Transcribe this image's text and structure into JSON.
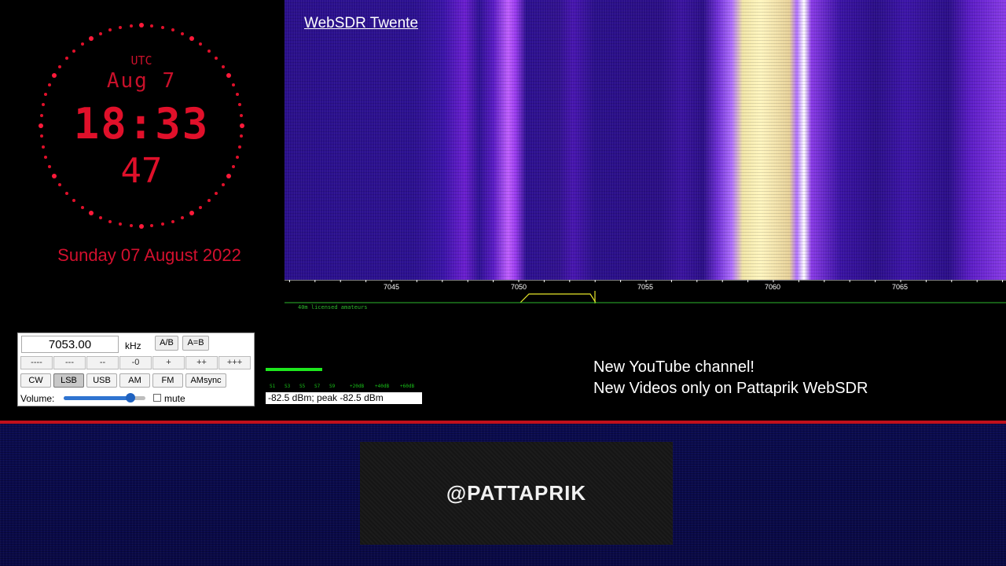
{
  "clock": {
    "zone": "UTC",
    "date": "Aug 7",
    "time": "18:33",
    "seconds": "47",
    "full_date": "Sunday 07 August 2022"
  },
  "waterfall": {
    "title": "WebSDR Twente",
    "scale_labels": [
      "7045",
      "7050",
      "7055",
      "7060",
      "7065"
    ],
    "band_label": "40m licensed amateurs"
  },
  "panel": {
    "frequency": "7053.00",
    "unit": "kHz",
    "ab_button": "A/B",
    "aeqb_button": "A=B",
    "step_buttons": [
      "----",
      "---",
      "--",
      "-0",
      "+",
      "++",
      "+++"
    ],
    "modes": [
      "CW",
      "LSB",
      "USB",
      "AM",
      "FM",
      "AMsync"
    ],
    "active_mode": "LSB",
    "volume_label": "Volume:",
    "volume_level": 0.82,
    "mute_label": "mute"
  },
  "smeter": {
    "ticks": [
      "S1",
      "S3",
      "S5",
      "S7",
      "S9",
      "+20dB",
      "+40dB",
      "+60dB"
    ],
    "reading": "-82.5 dBm; peak  -82.5 dBm"
  },
  "announcement": {
    "line1": "New YouTube channel!",
    "line2": "New Videos only on Pattaprik WebSDR"
  },
  "branding": {
    "handle": "@PATTAPRIK"
  },
  "colors": {
    "clock_red": "#e0102a",
    "divider_red": "#c0101c",
    "passband_yellow": "#e6e62a",
    "scale_green": "#2db82d"
  }
}
